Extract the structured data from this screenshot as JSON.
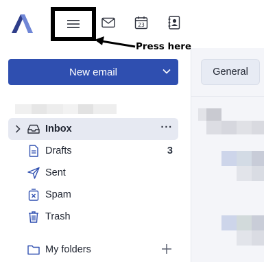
{
  "header": {
    "annotation_label": "Press here",
    "icons": [
      "app-logo",
      "hamburger-menu-icon",
      "mail-icon",
      "calendar-icon",
      "contacts-icon"
    ],
    "calendar_day": "23"
  },
  "sidebar": {
    "new_email_label": "New email",
    "items": [
      {
        "label": "Inbox",
        "icon": "inbox-icon",
        "active": true,
        "more": "···"
      },
      {
        "label": "Drafts",
        "icon": "draft-file-icon",
        "count": "3"
      },
      {
        "label": "Sent",
        "icon": "paper-plane-icon"
      },
      {
        "label": "Spam",
        "icon": "spam-icon"
      },
      {
        "label": "Trash",
        "icon": "trash-icon"
      }
    ],
    "folders_label": "My folders"
  },
  "content": {
    "tab_label": "General"
  },
  "colors": {
    "primary": "#2f4fb0",
    "logo_dark": "#2f3e8a",
    "logo_light": "#6f86d6",
    "active_item_bg": "#e6e9f2",
    "annotation": "#000000"
  }
}
